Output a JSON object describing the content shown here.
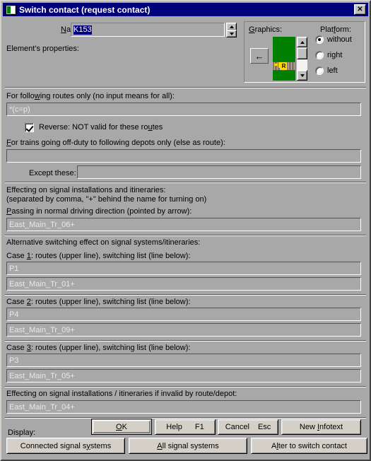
{
  "window": {
    "title": "Switch contact (request contact)",
    "close_label": "✕",
    "icon": "window-app-icon"
  },
  "name_row": {
    "label": "Name:",
    "value": "K153",
    "spin_up": "▲",
    "spin_down": "▼"
  },
  "element_properties_label": "Element's properties:",
  "graphics": {
    "legend": "Graphics:",
    "back_arrow": "←",
    "scroll_up": "▲",
    "scroll_down": "▼",
    "preview_badge": "R",
    "preview_background": "#008000"
  },
  "platform": {
    "legend": "Platform:",
    "options": [
      {
        "label": "without",
        "selected": true
      },
      {
        "label": "right",
        "selected": false
      },
      {
        "label": "left",
        "selected": false
      }
    ]
  },
  "routes_section": {
    "label": "For following routes only (no input means for all):",
    "value": "*(c=p)",
    "reverse_checkbox": {
      "label": "Reverse: NOT valid for these routes",
      "checked": true
    }
  },
  "depots_section": {
    "label": "For trains going off-duty to following depots only (else as route):",
    "value": "",
    "except_label": "Except these:",
    "except_value": ""
  },
  "effecting_section": {
    "label_line1": "Effecting on signal installations and itineraries:",
    "label_line2": "(separated by comma, \"+\" behind the name for turning on)",
    "passing_label": "Passing in normal driving direction (pointed by arrow):",
    "passing_value": "East_Main_Tr_06+"
  },
  "alternative_section": {
    "label": "Alternative switching effect on signal systems/itineraries:",
    "cases": [
      {
        "label": "Case 1: routes (upper line), switching list (line below):",
        "routes": "P1",
        "switching_list": "East_Main_Tr_01+"
      },
      {
        "label": "Case 2: routes (upper line), switching list (line below):",
        "routes": "P4",
        "switching_list": "East_Main_Tr_09+"
      },
      {
        "label": "Case 3: routes (upper line), switching list (line below):",
        "routes": "P3",
        "switching_list": "East_Main_Tr_05+"
      }
    ]
  },
  "invalid_section": {
    "label": "Effecting on signal installations / itineraries if invalid by route/depot:",
    "value": "East_Main_Tr_04+"
  },
  "footer": {
    "display_label": "Display:",
    "ok_button": "OK",
    "help_button": "Help",
    "help_key": "F1",
    "cancel_button": "Cancel",
    "cancel_key": "Esc",
    "new_infotext_button": "New Infotext",
    "connected_signal_systems_button": "Connected signal systems",
    "all_signal_systems_button": "All signal systems",
    "alter_to_switch_contact_button": "Alter to switch contact"
  }
}
